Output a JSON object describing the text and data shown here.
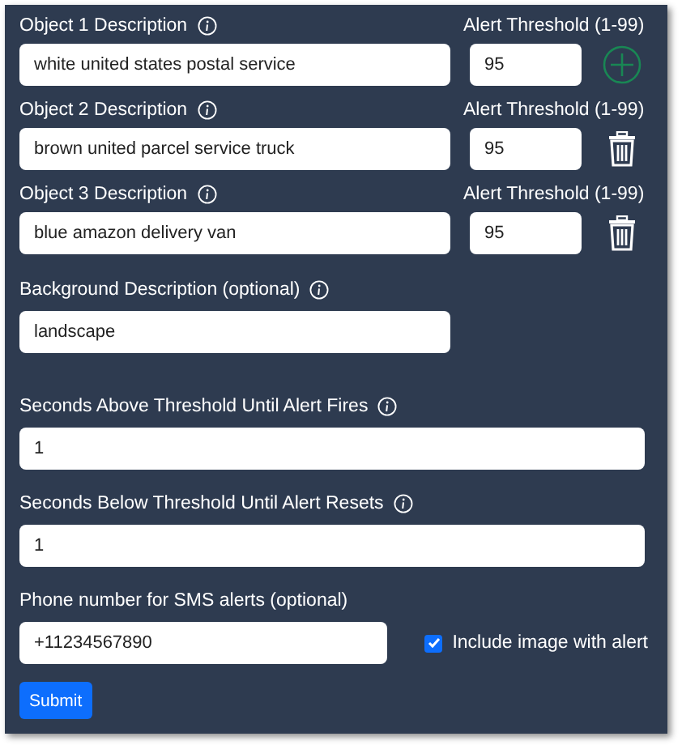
{
  "objects": [
    {
      "label": "Object 1 Description",
      "value": "white united states postal service",
      "threshold_label": "Alert Threshold (1-99)",
      "threshold": "95",
      "kind": "add"
    },
    {
      "label": "Object 2 Description",
      "value": "brown united parcel service truck",
      "threshold_label": "Alert Threshold (1-99)",
      "threshold": "95",
      "kind": "delete"
    },
    {
      "label": "Object 3 Description",
      "value": "blue amazon delivery van",
      "threshold_label": "Alert Threshold (1-99)",
      "threshold": "95",
      "kind": "delete"
    }
  ],
  "background": {
    "label": "Background Description (optional)",
    "value": "landscape"
  },
  "seconds_above": {
    "label": "Seconds Above Threshold Until Alert Fires",
    "value": "1"
  },
  "seconds_below": {
    "label": "Seconds Below Threshold Until Alert Resets",
    "value": "1"
  },
  "phone": {
    "label": "Phone number for SMS alerts (optional)",
    "value": "+11234567890"
  },
  "include_image": {
    "label": "Include image with alert",
    "checked": true
  },
  "submit": "Submit"
}
